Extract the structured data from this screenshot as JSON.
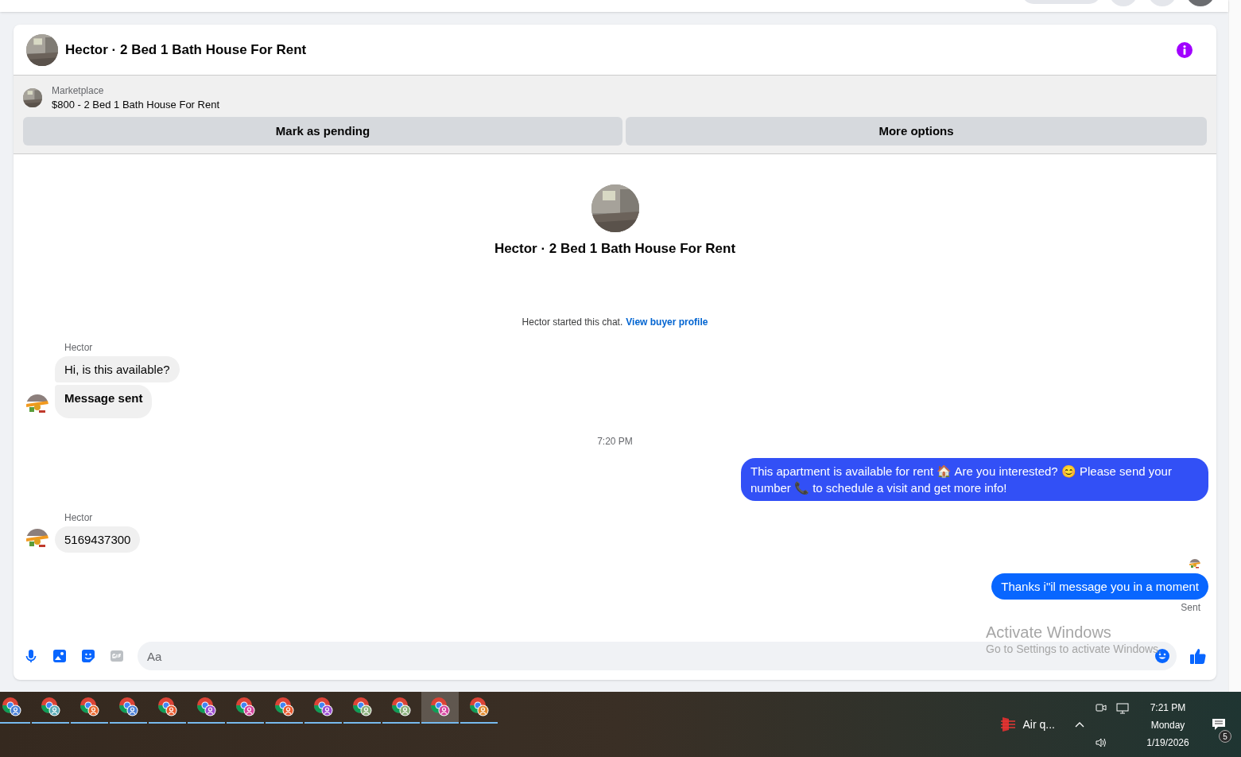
{
  "header": {
    "title": "Hector · 2 Bed 1 Bath House For Rent"
  },
  "listing": {
    "source": "Marketplace",
    "title": "$800 - 2 Bed 1 Bath House For Rent",
    "actions": [
      "Mark as pending",
      "More options"
    ]
  },
  "intro": {
    "title": "Hector · 2 Bed 1 Bath House For Rent",
    "note": "Hector started this chat.",
    "link": "View buyer profile"
  },
  "messages": [
    {
      "kind": "incoming",
      "sender": "Hector",
      "bubbles": [
        {
          "text": "Hi, is this available?",
          "bold": false
        },
        {
          "text": "Message sent",
          "bold": true
        }
      ]
    },
    {
      "kind": "time",
      "text": "7:20 PM"
    },
    {
      "kind": "outgoing",
      "text": "This apartment is available for rent 🏠 Are you interested? 😊 Please send your number 📞 to schedule a visit and get more info!",
      "color": "#3250f6"
    },
    {
      "kind": "incoming",
      "sender": "Hector",
      "bubbles": [
        {
          "text": "5169437300",
          "bold": false
        }
      ]
    },
    {
      "kind": "read"
    },
    {
      "kind": "outgoing",
      "text": "Thanks i\"il message you in a moment",
      "color": "#0866ff",
      "status": "Sent"
    }
  ],
  "composer": {
    "placeholder": "Aa"
  },
  "activation": {
    "title": "Activate Windows",
    "hint": "Go to Settings to activate Windows."
  },
  "taskbar": {
    "apps": [
      {
        "color": "#4a7fd6",
        "selected": false
      },
      {
        "color": "#5aa9b5",
        "selected": false
      },
      {
        "color": "#e8662d",
        "selected": false
      },
      {
        "color": "#4a7fd6",
        "selected": false
      },
      {
        "color": "#e8582d",
        "selected": false
      },
      {
        "color": "#9b4dd0",
        "selected": false
      },
      {
        "color": "#d4449e",
        "selected": false
      },
      {
        "color": "#e8582d",
        "selected": false
      },
      {
        "color": "#9b4dd0",
        "selected": false
      },
      {
        "color": "#8aae7a",
        "selected": false
      },
      {
        "color": "#8aae7a",
        "selected": false
      },
      {
        "color": "#d4449e",
        "selected": true
      },
      {
        "color": "#e0892d",
        "selected": false
      }
    ],
    "weather": "Air q...",
    "time": "7:21 PM",
    "day": "Monday",
    "date": "1/19/2026",
    "notifications": "5"
  }
}
